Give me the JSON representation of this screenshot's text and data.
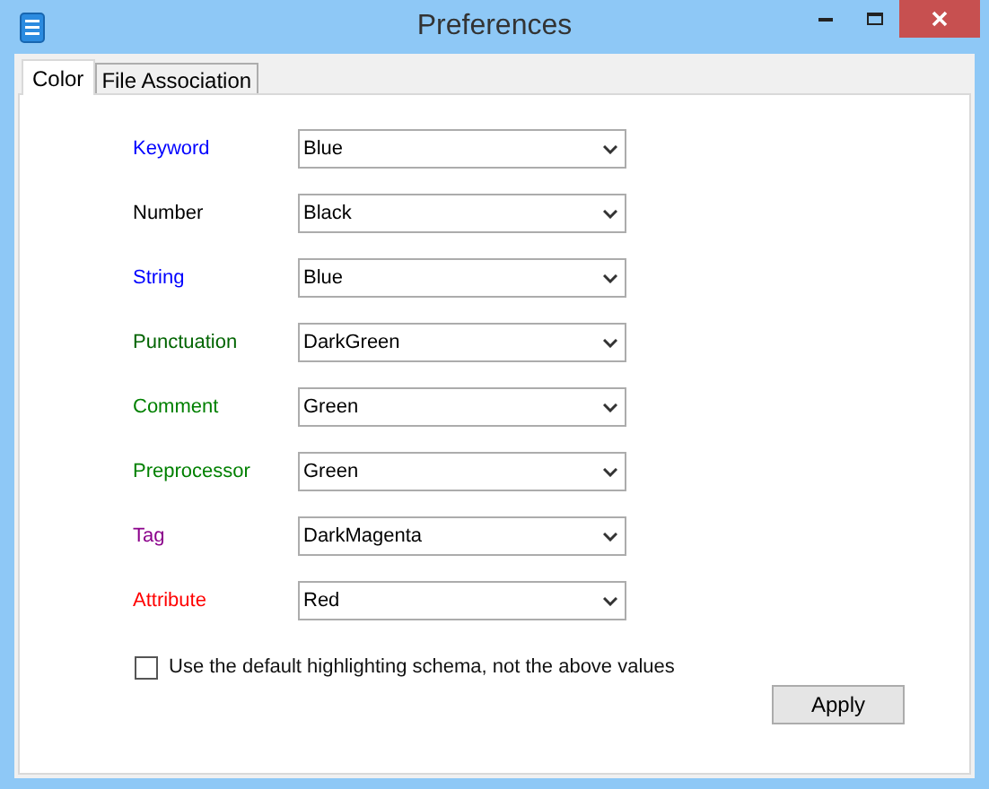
{
  "window": {
    "title": "Preferences"
  },
  "tabs": [
    {
      "label": "Color",
      "selected": true
    },
    {
      "label": "File Association",
      "selected": false
    }
  ],
  "color_settings": [
    {
      "label": "Keyword",
      "color": "#0000ff",
      "value": "Blue"
    },
    {
      "label": "Number",
      "color": "#000000",
      "value": "Black"
    },
    {
      "label": "String",
      "color": "#0000ff",
      "value": "Blue"
    },
    {
      "label": "Punctuation",
      "color": "#006400",
      "value": "DarkGreen"
    },
    {
      "label": "Comment",
      "color": "#008000",
      "value": "Green"
    },
    {
      "label": "Preprocessor",
      "color": "#008000",
      "value": "Green"
    },
    {
      "label": "Tag",
      "color": "#8b008b",
      "value": "DarkMagenta"
    },
    {
      "label": "Attribute",
      "color": "#ff0000",
      "value": "Red"
    }
  ],
  "default_schema_checkbox": {
    "label": "Use the default highlighting schema, not the above values",
    "checked": false
  },
  "apply_button": "Apply"
}
